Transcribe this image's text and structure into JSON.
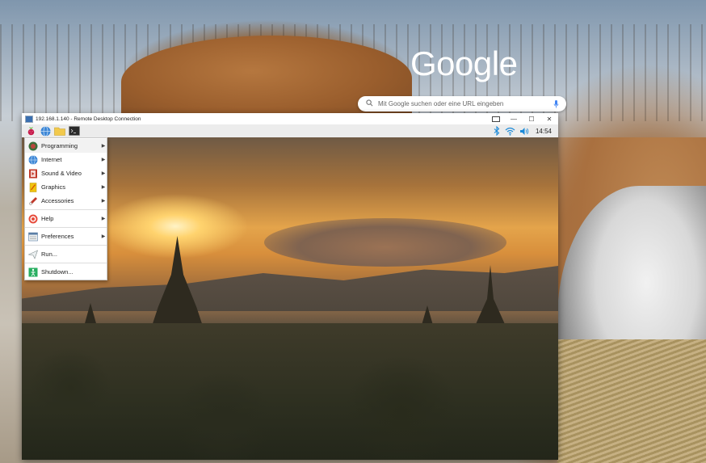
{
  "google": {
    "logo_text": "Google",
    "search_placeholder": "Mit Google suchen oder eine URL eingeben"
  },
  "rdp_window": {
    "title": "192.168.1.140 - Remote Desktop Connection",
    "buttons": {
      "minimize": "—",
      "maximize": "☐",
      "close": "✕"
    }
  },
  "taskbar": {
    "launchers": [
      "raspberry-menu",
      "web-browser",
      "file-manager",
      "terminal"
    ],
    "clock": "14:54"
  },
  "start_menu": {
    "items": [
      {
        "label": "Programming",
        "icon": "programming-icon",
        "submenu": true
      },
      {
        "label": "Internet",
        "icon": "internet-icon",
        "submenu": true
      },
      {
        "label": "Sound & Video",
        "icon": "sound-video-icon",
        "submenu": true
      },
      {
        "label": "Graphics",
        "icon": "graphics-icon",
        "submenu": true
      },
      {
        "label": "Accessories",
        "icon": "accessories-icon",
        "submenu": true
      },
      {
        "label": "Help",
        "icon": "help-icon",
        "submenu": true
      },
      {
        "label": "Preferences",
        "icon": "preferences-icon",
        "submenu": true
      },
      {
        "label": "Run...",
        "icon": "run-icon",
        "submenu": false
      },
      {
        "label": "Shutdown...",
        "icon": "shutdown-icon",
        "submenu": false
      }
    ]
  },
  "colors": {
    "raspberry": "#c51a4a",
    "leaf": "#6cc04a",
    "tray_blue": "#1c8ad8"
  }
}
